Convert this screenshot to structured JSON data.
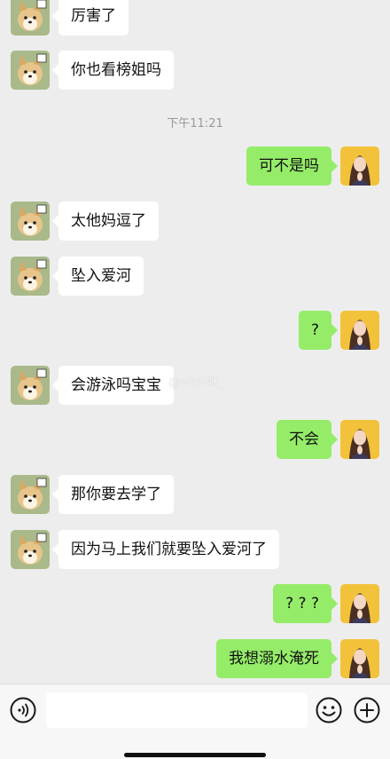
{
  "colors": {
    "background": "#ededed",
    "bubble_self": "#95ec69",
    "bubble_other": "#ffffff",
    "timestamp": "#999999"
  },
  "chat": {
    "timestamp": "下午11:21",
    "watermark": "@whai呀_",
    "messages": [
      {
        "side": "left",
        "text": "厉害了",
        "avatar": "shiba-dog-avatar"
      },
      {
        "side": "left",
        "text": "你也看榜姐吗",
        "avatar": "shiba-dog-avatar"
      },
      {
        "side": "right",
        "text": "可不是吗",
        "avatar": "girl-praying-avatar"
      },
      {
        "side": "left",
        "text": "太他妈逗了",
        "avatar": "shiba-dog-avatar"
      },
      {
        "side": "left",
        "text": "坠入爱河",
        "avatar": "shiba-dog-avatar"
      },
      {
        "side": "right",
        "text": "?",
        "avatar": "girl-praying-avatar"
      },
      {
        "side": "left",
        "text": "会游泳吗宝宝",
        "avatar": "shiba-dog-avatar"
      },
      {
        "side": "right",
        "text": "不会",
        "avatar": "girl-praying-avatar"
      },
      {
        "side": "left",
        "text": "那你要去学了",
        "avatar": "shiba-dog-avatar"
      },
      {
        "side": "left",
        "text": "因为马上我们就要坠入爱河了",
        "avatar": "shiba-dog-avatar"
      },
      {
        "side": "right",
        "text": "? ? ?",
        "avatar": "girl-praying-avatar"
      },
      {
        "side": "right",
        "text": "我想溺水淹死",
        "avatar": "girl-praying-avatar"
      }
    ]
  },
  "input_bar": {
    "value": "",
    "voice_icon": "voice-icon",
    "emoji_icon": "emoji-icon",
    "plus_icon": "plus-icon"
  }
}
